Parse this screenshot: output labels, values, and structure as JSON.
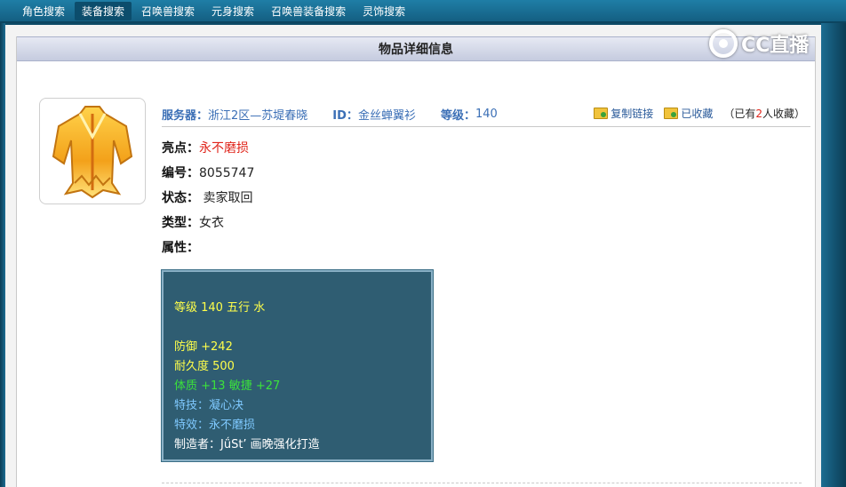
{
  "nav": {
    "tabs": [
      {
        "label": "角色搜索",
        "active": false
      },
      {
        "label": "装备搜索",
        "active": true
      },
      {
        "label": "召唤兽搜索",
        "active": false
      },
      {
        "label": "元身搜索",
        "active": false
      },
      {
        "label": "召唤兽装备搜索",
        "active": false
      },
      {
        "label": "灵饰搜索",
        "active": false
      }
    ]
  },
  "logo": {
    "text": "CC直播"
  },
  "panel": {
    "title": "物品详细信息"
  },
  "item": {
    "image_icon": "robe-icon",
    "server_label": "服务器：",
    "server": "浙江2区—苏堤春晓",
    "id_label": "ID：",
    "id": "金丝蝉翼衫",
    "level_label": "等级：",
    "level": "140",
    "copy_link": "复制链接",
    "favorited": "已收藏",
    "fav_prefix": "（已有",
    "fav_count": "2",
    "fav_suffix": "人收藏）",
    "highlight_label": "亮点：",
    "highlight": "永不磨损",
    "number_label": "编号：",
    "number": "8055747",
    "status_label": "状态：",
    "status": "卖家取回",
    "type_label": "类型：",
    "type": "女衣",
    "attr_label": "属性："
  },
  "attributes": {
    "line1": "等级 140 五行 水",
    "line2": "防御 +242",
    "line3": "耐久度 500",
    "line4": "体质 +13 敏捷 +27",
    "line5": "特技：凝心决",
    "line6": "特效：永不磨损",
    "line7": "制造者：JǘSt’ 画晚强化打造"
  },
  "colors": {
    "nav_bg": "#1f7ea6",
    "attr_bg": "#2f5d72",
    "attr_yellow": "#ffff4a",
    "attr_green": "#3be23b",
    "attr_blue": "#7fc9ff",
    "accent_blue": "#3b6fb6",
    "highlight_red": "#e0251b"
  }
}
